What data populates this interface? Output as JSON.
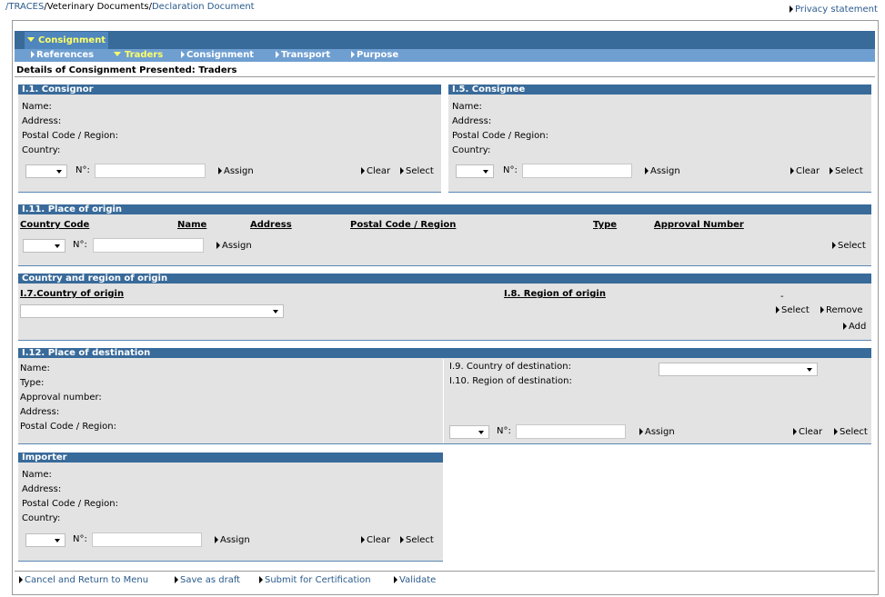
{
  "breadcrumb": {
    "sep": "/",
    "root": "TRACES",
    "mid": "Veterinary Documents",
    "current": "Declaration Document"
  },
  "privacy": "Privacy statement",
  "main_tab": "Consignment",
  "subtabs": [
    "References",
    "Traders",
    "Consignment",
    "Transport",
    "Purpose"
  ],
  "page_title": "Details of Consignment Presented: Traders",
  "common": {
    "name": "Name:",
    "address": "Address:",
    "postal": "Postal Code / Region:",
    "country": "Country:",
    "no": "N°:",
    "assign": "Assign",
    "clear": "Clear",
    "select": "Select",
    "type": "Type:",
    "approval": "Approval number:"
  },
  "consignor": {
    "title": "I.1. Consignor"
  },
  "consignee": {
    "title": "I.5. Consignee"
  },
  "origin": {
    "title": "I.11. Place of origin",
    "columns": [
      "Country Code",
      "Name",
      "Address",
      "Postal Code / Region",
      "Type",
      "Approval Number"
    ]
  },
  "country_region": {
    "title": "Country and region of origin",
    "country_label": "I.7.Country of origin",
    "region_label": "I.8. Region of origin",
    "dash": "-",
    "remove": "Remove",
    "add": "Add"
  },
  "destination": {
    "title": "I.12. Place of destination",
    "country_label": "I.9. Country of destination:",
    "region_label": "I.10. Region of destination:"
  },
  "importer": {
    "title": "Importer"
  },
  "footer": [
    "Cancel and Return to Menu",
    "Save as draft",
    "Submit for Certification",
    "Validate"
  ]
}
